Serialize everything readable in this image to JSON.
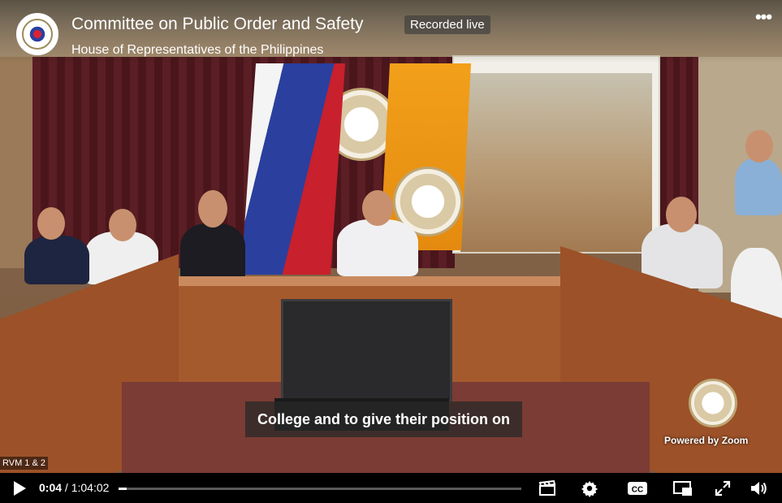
{
  "header": {
    "title": "Committee on Public Order and Safety",
    "badge": "Recorded live",
    "subtitle": "House of Representatives of the Philippines",
    "more_icon": "more-horizontal-icon"
  },
  "video": {
    "caption": "College and to give their position on",
    "watermark": "Powered by Zoom",
    "corner_label": "RVM 1 & 2"
  },
  "controls": {
    "current_time": "0:04",
    "separator": " / ",
    "duration": "1:04:02",
    "progress_fraction": 0.001,
    "icons": [
      "play-icon",
      "clapperboard-icon",
      "settings-gear-icon",
      "closed-captions-icon",
      "picture-in-picture-icon",
      "fullscreen-icon",
      "volume-icon"
    ],
    "cc_label": "CC"
  },
  "colors": {
    "control_bar": "#000000",
    "progress_track": "#5a5a5a",
    "progress_fill": "#ffffff"
  }
}
